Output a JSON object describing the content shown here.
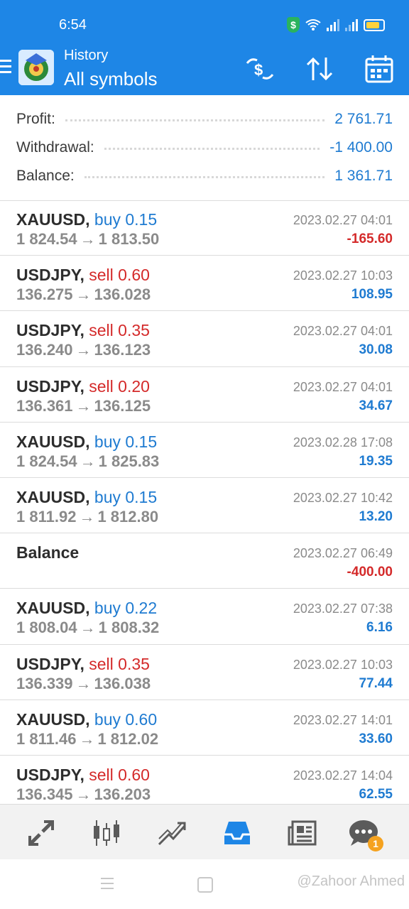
{
  "status": {
    "time": "6:54"
  },
  "header": {
    "subtitle": "History",
    "title": "All symbols"
  },
  "summary": {
    "profit_label": "Profit:",
    "profit": "2 761.71",
    "withdrawal_label": "Withdrawal:",
    "withdrawal": "-1 400.00",
    "balance_label": "Balance:",
    "balance": "1 361.71"
  },
  "trades": [
    {
      "symbol": "XAUUSD,",
      "side": "buy 0.15",
      "open": "1 824.54",
      "close": "1 813.50",
      "date": "2023.02.27 04:01",
      "profit": "-165.60"
    },
    {
      "symbol": "USDJPY,",
      "side": "sell 0.60",
      "open": "136.275",
      "close": "136.028",
      "date": "2023.02.27 10:03",
      "profit": "108.95"
    },
    {
      "symbol": "USDJPY,",
      "side": "sell 0.35",
      "open": "136.240",
      "close": "136.123",
      "date": "2023.02.27 04:01",
      "profit": "30.08"
    },
    {
      "symbol": "USDJPY,",
      "side": "sell 0.20",
      "open": "136.361",
      "close": "136.125",
      "date": "2023.02.27 04:01",
      "profit": "34.67"
    },
    {
      "symbol": "XAUUSD,",
      "side": "buy 0.15",
      "open": "1 824.54",
      "close": "1 825.83",
      "date": "2023.02.28 17:08",
      "profit": "19.35"
    },
    {
      "symbol": "XAUUSD,",
      "side": "buy 0.15",
      "open": "1 811.92",
      "close": "1 812.80",
      "date": "2023.02.27 10:42",
      "profit": "13.20"
    },
    {
      "symbol": "Balance",
      "side": "",
      "open": "",
      "close": "",
      "date": "2023.02.27 06:49",
      "profit": "-400.00"
    },
    {
      "symbol": "XAUUSD,",
      "side": "buy 0.22",
      "open": "1 808.04",
      "close": "1 808.32",
      "date": "2023.02.27 07:38",
      "profit": "6.16"
    },
    {
      "symbol": "USDJPY,",
      "side": "sell 0.35",
      "open": "136.339",
      "close": "136.038",
      "date": "2023.02.27 10:03",
      "profit": "77.44"
    },
    {
      "symbol": "XAUUSD,",
      "side": "buy 0.60",
      "open": "1 811.46",
      "close": "1 812.02",
      "date": "2023.02.27 14:01",
      "profit": "33.60"
    },
    {
      "symbol": "USDJPY,",
      "side": "sell 0.60",
      "open": "136.345",
      "close": "136.203",
      "date": "2023.02.27 14:04",
      "profit": "62.55"
    }
  ],
  "arrow": "→",
  "nav": {
    "badge": "1"
  },
  "icons": [
    "menu-icon",
    "terminal-logo-icon",
    "deposit-icon",
    "sort-icon",
    "calendar-icon",
    "trade-icon",
    "chart-icon",
    "trend-icon",
    "history-icon",
    "news-icon",
    "chat-icon"
  ],
  "colors": {
    "accent": "#1e86e6",
    "positive": "#1f7bd1",
    "negative": "#d42a2a"
  },
  "watermark": "@Zahoor Ahmed"
}
